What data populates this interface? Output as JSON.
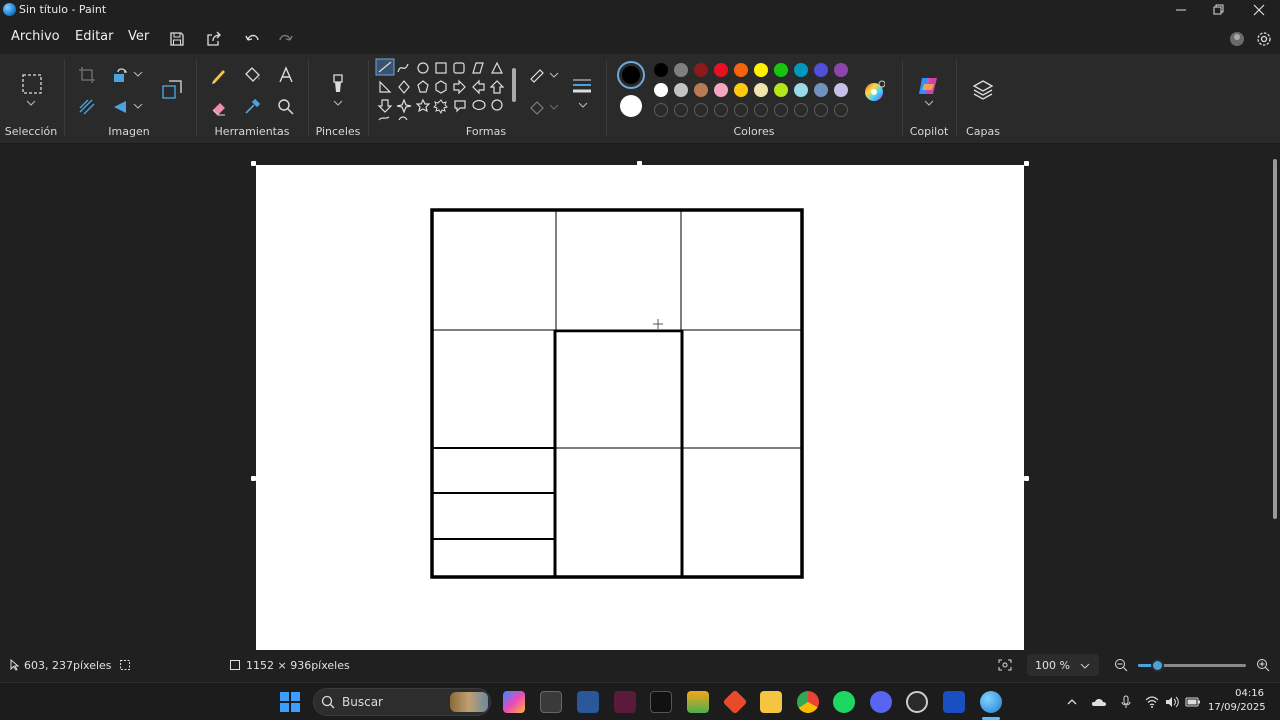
{
  "window": {
    "title": "Sin título - Paint"
  },
  "menu": {
    "file": "Archivo",
    "edit": "Editar",
    "view": "Ver"
  },
  "ribbon": {
    "groups": {
      "selection": "Selección",
      "image": "Imagen",
      "tools": "Herramientas",
      "brushes": "Pinceles",
      "shapes": "Formas",
      "colors": "Colores",
      "copilot": "Copilot",
      "layers": "Capas"
    },
    "colors": {
      "primary": "#000000",
      "secondary": "#ffffff",
      "palette_row1": [
        "#000000",
        "#7f7f7f",
        "#8b1a1a",
        "#e81123",
        "#f7630c",
        "#fff100",
        "#16c60c",
        "#0099bc",
        "#4f4fd8",
        "#8e44ad"
      ],
      "palette_row2": [
        "#ffffff",
        "#c3c3c3",
        "#b97a57",
        "#f4a6c0",
        "#ffc90e",
        "#efe4b0",
        "#b5e61d",
        "#99d9ea",
        "#7092be",
        "#c8bfe7"
      ]
    }
  },
  "status": {
    "cursor_position": "603, 237píxeles",
    "canvas_size": "1152 × 936píxeles",
    "zoom": "100 %"
  },
  "taskbar": {
    "search_placeholder": "Buscar",
    "time": "04:16",
    "date": "17/09/2025"
  }
}
